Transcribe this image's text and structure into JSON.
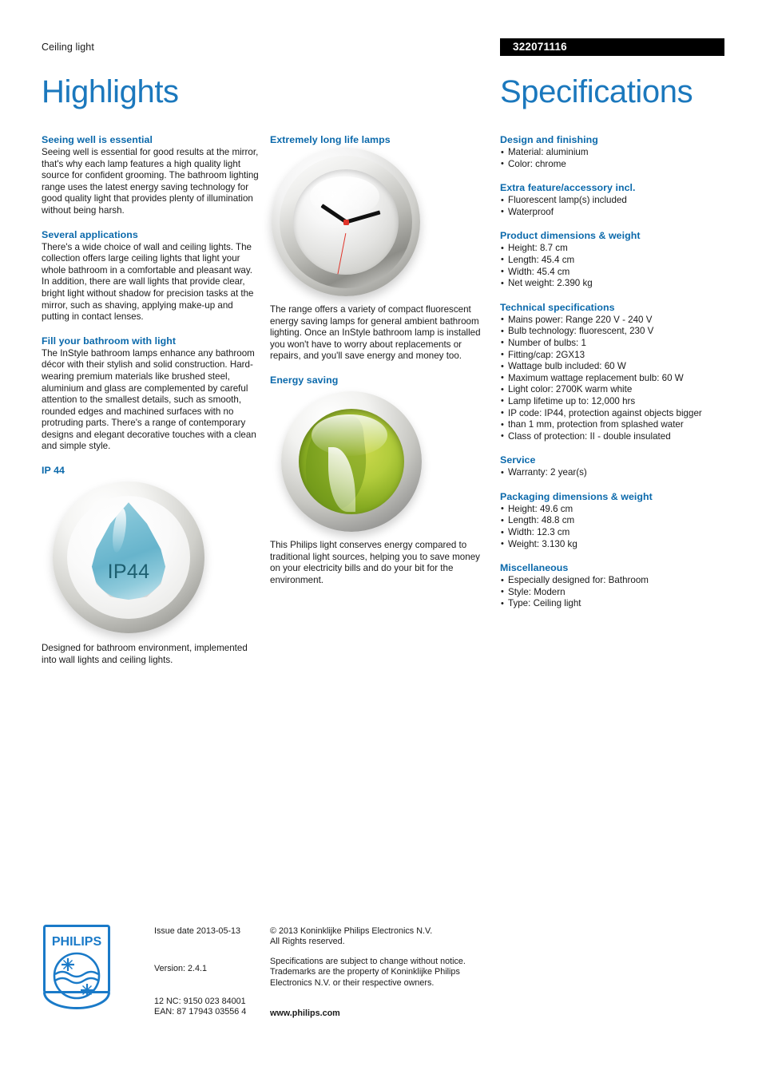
{
  "header": {
    "kicker": "Ceiling light",
    "product_code": "322071116",
    "title_left": "Highlights",
    "title_right": "Specifications"
  },
  "highlights": {
    "column1": [
      {
        "heading": "Seeing well is essential",
        "body": "Seeing well is essential for good results at the mirror, that's why each lamp features a high quality light source for confident grooming. The bathroom lighting range uses the latest energy saving technology for good quality light that provides plenty of illumination without being harsh."
      },
      {
        "heading": "Several applications",
        "body": "There's a wide choice of wall and ceiling lights. The collection offers large ceiling lights that light your whole bathroom in a comfortable and pleasant way. In addition, there are wall lights that provide clear, bright light without shadow for precision tasks at the mirror, such as shaving, applying make-up and putting in contact lenses."
      },
      {
        "heading": "Fill your bathroom with light",
        "body": "The InStyle bathroom lamps enhance any bathroom décor with their stylish and solid construction. Hard-wearing premium materials like brushed steel, aluminium and glass are complemented by careful attention to the smallest details, such as smooth, rounded edges and machined surfaces with no protruding parts. There's a range of contemporary designs and elegant decorative touches with a clean and simple style."
      },
      {
        "heading": "IP 44",
        "image": "ip44-badge",
        "image_label": "IP44",
        "body": "Designed for bathroom environment, implemented into wall lights and ceiling lights."
      }
    ],
    "column2": [
      {
        "heading": "Extremely long life lamps",
        "image": "clock-icon",
        "body": "The range offers a variety of compact fluorescent energy saving lamps for general ambient bathroom lighting. Once an InStyle bathroom lamp is installed you won't have to worry about replacements or repairs, and you'll save energy and money too."
      },
      {
        "heading": "Energy saving",
        "image": "green-leaf-icon",
        "body": "This Philips light conserves energy compared to traditional light sources, helping you to save money on your electricity bills and do your bit for the environment."
      }
    ]
  },
  "specifications": [
    {
      "heading": "Design and finishing",
      "items": [
        "Material: aluminium",
        "Color: chrome"
      ]
    },
    {
      "heading": "Extra feature/accessory incl.",
      "items": [
        "Fluorescent lamp(s) included",
        "Waterproof"
      ]
    },
    {
      "heading": "Product dimensions & weight",
      "items": [
        "Height: 8.7 cm",
        "Length: 45.4 cm",
        "Width: 45.4 cm",
        "Net weight: 2.390 kg"
      ]
    },
    {
      "heading": "Technical specifications",
      "items": [
        "Mains power: Range 220 V - 240 V",
        "Bulb technology: fluorescent, 230 V",
        "Number of bulbs: 1",
        "Fitting/cap: 2GX13",
        "Wattage bulb included: 60 W",
        "Maximum wattage replacement bulb: 60 W",
        "Light color: 2700K warm white",
        "Lamp lifetime up to: 12,000 hrs",
        "IP code: IP44, protection against objects bigger",
        "Class of protection: II - double insulated"
      ],
      "continuation": "than 1 mm, protection from splashed water",
      "continuation_after_index": 8
    },
    {
      "heading": "Service",
      "items": [
        "Warranty: 2 year(s)"
      ]
    },
    {
      "heading": "Packaging dimensions & weight",
      "items": [
        "Height: 49.6 cm",
        "Length: 48.8 cm",
        "Width: 12.3 cm",
        "Weight: 3.130 kg"
      ]
    },
    {
      "heading": "Miscellaneous",
      "items": [
        "Especially designed for: Bathroom",
        "Style: Modern",
        "Type: Ceiling light"
      ]
    }
  ],
  "footer": {
    "logo_wordmark": "PHILIPS",
    "issue_date": "Issue date 2013-05-13",
    "version": "Version: 2.4.1",
    "twelve_nc": "12 NC: 9150 023 84001",
    "ean": "EAN: 87 17943 03556 4",
    "copyright_line1": "© 2013 Koninklijke Philips Electronics N.V.",
    "copyright_line2": "All Rights reserved.",
    "disclaimer_line1": "Specifications are subject to change without notice.",
    "disclaimer_line2": "Trademarks are the property of Koninklijke Philips",
    "disclaimer_line3": "Electronics N.V. or their respective owners.",
    "website": "www.philips.com"
  },
  "colors": {
    "heading_blue": "#0b69ab",
    "title_blue": "#1b78bd",
    "code_bar_bg": "#000000",
    "text": "#1a1a1a",
    "droplet_teal": "#67b4cc",
    "leaf_green": "#87ab22"
  }
}
